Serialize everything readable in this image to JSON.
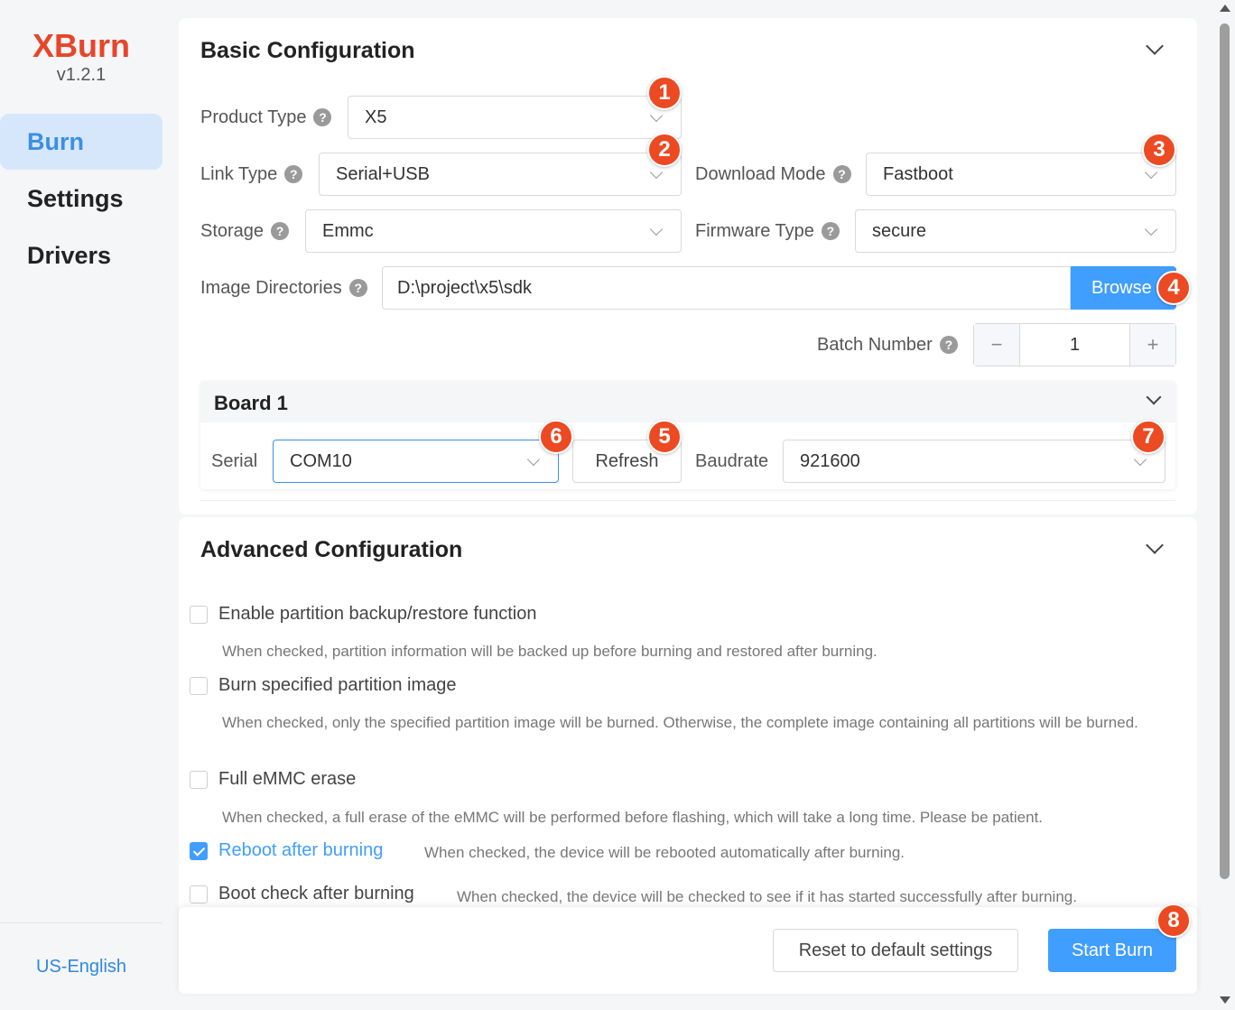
{
  "app": {
    "title": "XBurn",
    "version": "v1.2.1"
  },
  "nav": {
    "burn": "Burn",
    "settings": "Settings",
    "drivers": "Drivers"
  },
  "language": "US-English",
  "basic": {
    "title": "Basic Configuration",
    "product_type": {
      "label": "Product Type",
      "value": "X5"
    },
    "link_type": {
      "label": "Link Type",
      "value": "Serial+USB"
    },
    "download_mode": {
      "label": "Download Mode",
      "value": "Fastboot"
    },
    "storage": {
      "label": "Storage",
      "value": "Emmc"
    },
    "firmware_type": {
      "label": "Firmware Type",
      "value": "secure"
    },
    "image_dir": {
      "label": "Image Directories",
      "value": "D:\\project\\x5\\sdk",
      "browse": "Browse"
    },
    "batch": {
      "label": "Batch Number",
      "value": "1",
      "minus": "−",
      "plus": "+"
    },
    "board": {
      "title": "Board 1",
      "serial_label": "Serial",
      "serial_value": "COM10",
      "refresh": "Refresh",
      "baud_label": "Baudrate",
      "baud_value": "921600"
    }
  },
  "advanced": {
    "title": "Advanced Configuration",
    "options": [
      {
        "label": "Enable partition backup/restore function",
        "desc": "When checked, partition information will be backed up before burning and restored after burning.",
        "checked": false
      },
      {
        "label": "Burn specified partition image",
        "desc": "When checked, only the specified partition image will be burned. Otherwise, the complete image containing all partitions will be burned.",
        "checked": false
      },
      {
        "label": "Full eMMC erase",
        "desc": "When checked, a full erase of the eMMC will be performed before flashing, which will take a long time. Please be patient.",
        "checked": false
      },
      {
        "label": "Reboot after burning",
        "desc": "When checked, the device will be rebooted automatically after burning.",
        "checked": true
      },
      {
        "label": "Boot check after burning",
        "desc": "When checked, the device will be checked to see if it has started successfully after burning.",
        "checked": false
      }
    ]
  },
  "footer": {
    "reset": "Reset to default settings",
    "start": "Start Burn"
  },
  "badges": {
    "b1": "1",
    "b2": "2",
    "b3": "3",
    "b4": "4",
    "b5": "5",
    "b6": "6",
    "b7": "7",
    "b8": "8"
  },
  "help_glyph": "?",
  "colors": {
    "brand": "#e8452a",
    "primary": "#409eff",
    "badge": "#ec4a22",
    "nav_active_bg": "#d6e7fb"
  }
}
